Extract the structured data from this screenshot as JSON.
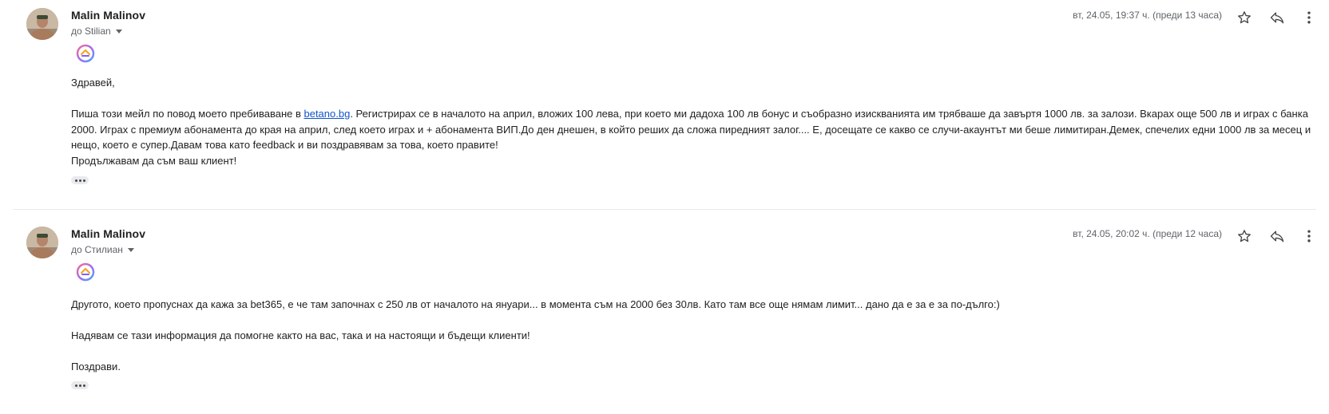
{
  "messages": [
    {
      "sender": "Malin Malinov",
      "recipient": "до Stilian",
      "date": "вт, 24.05, 19:37 ч. (преди 13 часа)",
      "greeting": "Здравей,",
      "p1_before_link": "Пиша този мейл по повод моето пребиваване в ",
      "link": "betano.bg",
      "p1_after_link": ". Регистрирах се в началото на април, вложих 100 лева, при което ми дадоха 100 лв бонус и съобразно изискванията им трябваше да завъртя 1000 лв. за залози. Вкарах още 500 лв и играх с банка 2000. Играх с премиум абонамента до края на април, след което играх и + абонамента ВИП.До ден днешен, в който реших да сложа пиредният залог.... Е, досещате се какво се случи-акаунтът ми беше лимитиран.Демек, спечелих едни 1000 лв за месец и нещо, което е супер.Давам това като feedback и ви поздравявам за това, което правите!",
      "closing": "Продължавам да съм ваш клиент!"
    },
    {
      "sender": "Malin Malinov",
      "recipient": "до Стилиан",
      "date": "вт, 24.05, 20:02 ч. (преди 12 часа)",
      "line1": "Другото, което пропуснах да кажа за bet365,  е че там започнах с 250 лв от началото на януари... в момента съм на 2000 без 30лв. Като там все още нямам лимит... дано да е за е за по-дълго:)",
      "line2": "Надявам се тази информация да помогне както на вас, така и на настоящи и бъдещи клиенти!",
      "line3": "Поздрави."
    }
  ],
  "icons": {
    "star": "star-outline-icon",
    "reply": "reply-icon",
    "more": "more-vert-icon",
    "extension": "extension-logo-icon"
  },
  "colors": {
    "link": "#1155cc",
    "secondary_text": "#5f6368"
  }
}
